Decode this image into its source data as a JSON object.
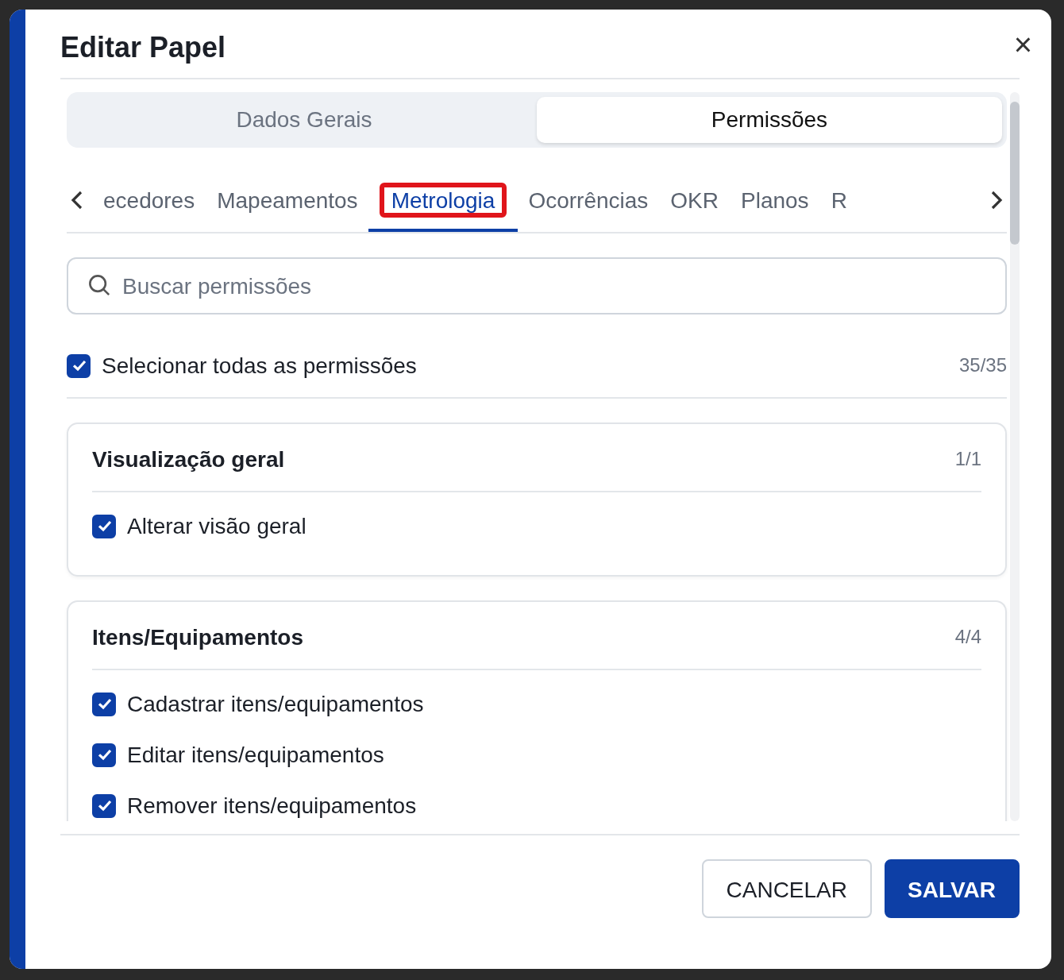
{
  "dialog": {
    "title": "Editar Papel",
    "close": "×"
  },
  "segments": [
    {
      "label": "Dados Gerais",
      "selected": false
    },
    {
      "label": "Permissões",
      "selected": true
    }
  ],
  "tabs": [
    {
      "label": "ecedores",
      "selected": false,
      "highlighted": false
    },
    {
      "label": "Mapeamentos",
      "selected": false,
      "highlighted": false
    },
    {
      "label": "Metrologia",
      "selected": true,
      "highlighted": true
    },
    {
      "label": "Ocorrências",
      "selected": false,
      "highlighted": false
    },
    {
      "label": "OKR",
      "selected": false,
      "highlighted": false
    },
    {
      "label": "Planos",
      "selected": false,
      "highlighted": false
    },
    {
      "label": "R",
      "selected": false,
      "highlighted": false
    }
  ],
  "search": {
    "placeholder": "Buscar permissões"
  },
  "select_all": {
    "label": "Selecionar todas as permissões",
    "checked": true,
    "count": "35/35"
  },
  "groups": [
    {
      "title": "Visualização geral",
      "count": "1/1",
      "items": [
        {
          "label": "Alterar visão geral",
          "checked": true
        }
      ]
    },
    {
      "title": "Itens/Equipamentos",
      "count": "4/4",
      "items": [
        {
          "label": "Cadastrar itens/equipamentos",
          "checked": true
        },
        {
          "label": "Editar itens/equipamentos",
          "checked": true
        },
        {
          "label": "Remover itens/equipamentos",
          "checked": true
        }
      ]
    }
  ],
  "buttons": [
    {
      "label": "CANCELAR",
      "kind": "secondary"
    },
    {
      "label": "SALVAR",
      "kind": "primary"
    }
  ]
}
